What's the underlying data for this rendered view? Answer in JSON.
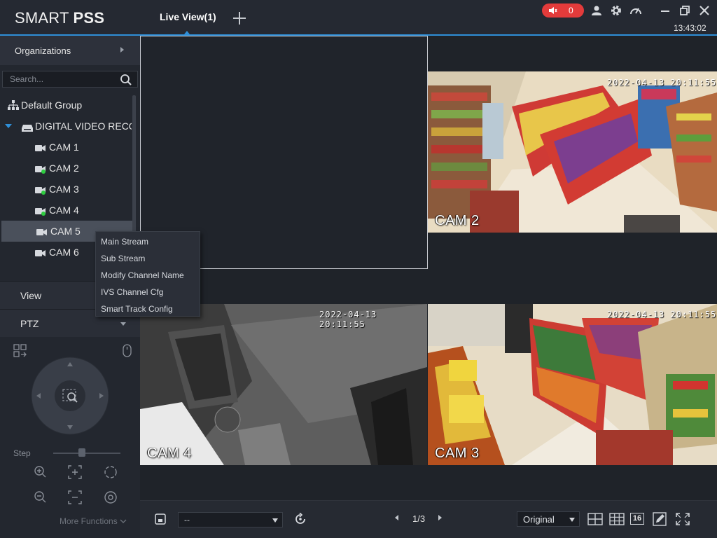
{
  "app": {
    "logo_light": "SMART ",
    "logo_bold": "PSS",
    "tab_label": "Live View(1)",
    "alarm_count": "0",
    "clock": "13:43:02"
  },
  "sidebar": {
    "organizations_label": "Organizations",
    "search_placeholder": "Search...",
    "tree": {
      "group": "Default Group",
      "device": "DIGITAL VIDEO RECO",
      "channels": [
        "CAM 1",
        "CAM 2",
        "CAM 3",
        "CAM 4",
        "CAM 5",
        "CAM 6"
      ],
      "online": [
        false,
        true,
        true,
        true,
        false,
        false
      ],
      "selected": "CAM 5"
    },
    "view_label": "View",
    "ptz_label": "PTZ",
    "step_label": "Step",
    "more_functions": "More Functions"
  },
  "context_menu": {
    "items": [
      "Main Stream",
      "Sub Stream",
      "Modify Channel Name",
      "IVS Channel Cfg",
      "Smart Track Config"
    ]
  },
  "grid": {
    "cells": [
      {
        "label": "",
        "timestamp": ""
      },
      {
        "label": "CAM 2",
        "timestamp": "2022-04-13 20:11:55"
      },
      {
        "label": "CAM 4",
        "timestamp": "2022-04-13 20:11:55"
      },
      {
        "label": "CAM 3",
        "timestamp": "2022-04-13 20:11:55"
      }
    ]
  },
  "bottombar": {
    "layout_value": "--",
    "page": "1/3",
    "ratio_value": "Original",
    "grid16_label": "16"
  },
  "colors": {
    "accent": "#2f8fd8",
    "alarm": "#e33b3b",
    "online_dot": "#2ecc40"
  }
}
